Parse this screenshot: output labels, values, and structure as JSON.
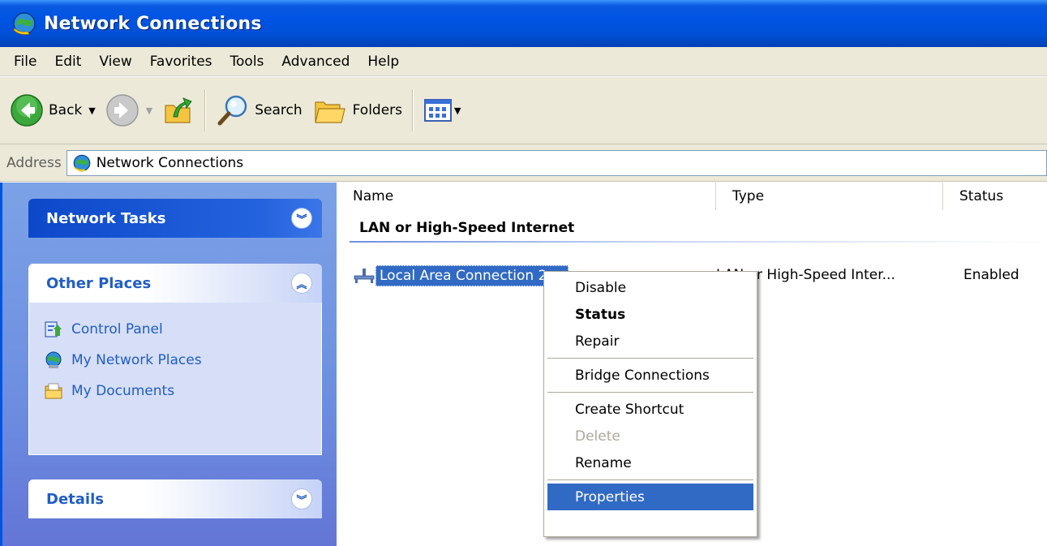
{
  "window": {
    "title": "Network Connections"
  },
  "menu": [
    "File",
    "Edit",
    "View",
    "Favorites",
    "Tools",
    "Advanced",
    "Help"
  ],
  "toolbar": {
    "back": "Back",
    "search": "Search",
    "folders": "Folders"
  },
  "address": {
    "label": "Address",
    "value": "Network Connections"
  },
  "taskpane": {
    "network_tasks": "Network Tasks",
    "other_places": "Other Places",
    "places": [
      "Control Panel",
      "My Network Places",
      "My Documents"
    ],
    "details": "Details"
  },
  "columns": [
    "Name",
    "Type",
    "Status"
  ],
  "group": "LAN or High-Speed Internet",
  "connection": {
    "name": "Local Area Connection 2",
    "type": "LAN or High-Speed Inter...",
    "status": "Enabled"
  },
  "context_menu": {
    "disable": "Disable",
    "status": "Status",
    "repair": "Repair",
    "bridge": "Bridge Connections",
    "shortcut": "Create Shortcut",
    "delete": "Delete",
    "rename": "Rename",
    "properties": "Properties"
  },
  "colors": {
    "titlebar": "#0054e3",
    "selection": "#316ac5",
    "taskpane": "#6d8ee0",
    "link": "#215dc6"
  }
}
